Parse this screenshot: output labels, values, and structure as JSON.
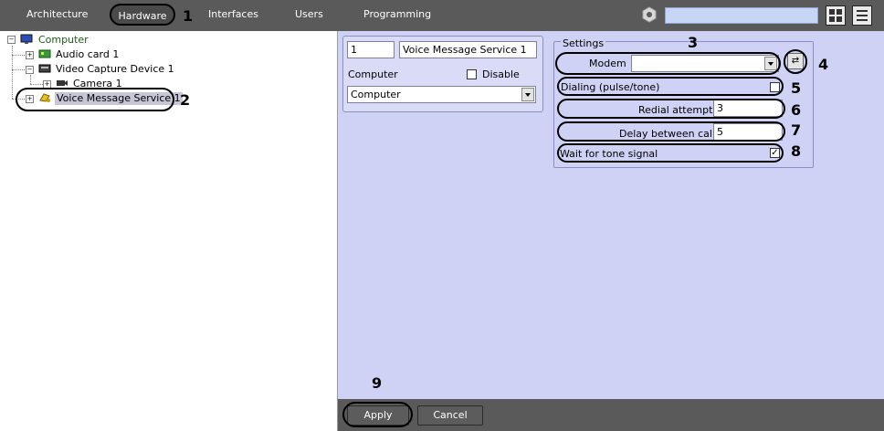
{
  "topbar": {
    "tabs": [
      {
        "label": "Architecture"
      },
      {
        "label": "Hardware"
      },
      {
        "label": "Interfaces"
      },
      {
        "label": "Users"
      },
      {
        "label": "Programming"
      }
    ],
    "search_value": ""
  },
  "tree": {
    "root": "Computer",
    "audio": "Audio card 1",
    "video": "Video Capture Device 1",
    "camera": "Camera 1",
    "voice": "Voice Message Service 1"
  },
  "object": {
    "id": "1",
    "name": "Voice Message Service 1",
    "computer_label": "Computer",
    "disable_label": "Disable",
    "computer_value": "Computer"
  },
  "settings": {
    "title": "Settings",
    "modem_label": "Modem",
    "modem_value": "",
    "dialing_label": "Dialing (pulse/tone)",
    "redial_label": "Redial attempts",
    "redial_value": "3",
    "delay_label": "Delay between calls",
    "delay_value": "5",
    "wait_label": "Wait for tone signal",
    "wait_checked": true,
    "dialing_checked": false
  },
  "footer": {
    "apply": "Apply",
    "cancel": "Cancel"
  },
  "callouts": [
    "1",
    "2",
    "3",
    "4",
    "5",
    "6",
    "7",
    "8",
    "9"
  ],
  "colors": {
    "topbar": "#5a5a5a",
    "panel": "#cfd2f5",
    "selected": "#c6c6d6"
  }
}
